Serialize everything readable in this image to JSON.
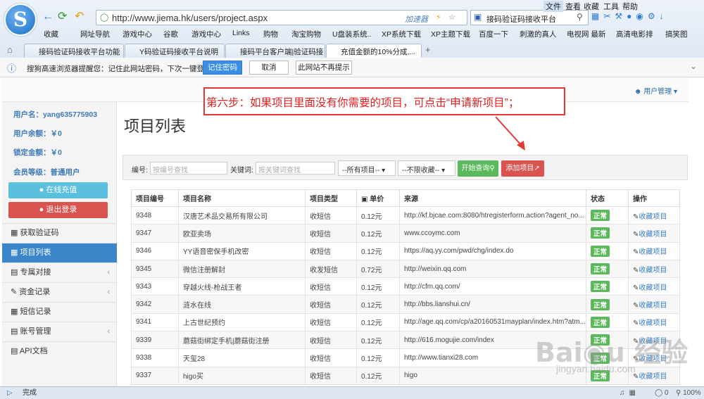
{
  "browser": {
    "url": "http://www.jiema.hk/users/project.aspx",
    "accelerator": "加速器",
    "search_text": "接码验证码接收平台",
    "menu": [
      "文件",
      "查看",
      "收藏",
      "工具",
      "帮助"
    ],
    "bookmarks": [
      "收藏",
      "网址导航",
      "游戏中心",
      "谷歌",
      "游戏中心",
      "Links",
      "购物",
      "淘宝购物",
      "U盘装系统..",
      "XP系统下载",
      "XP主题下载",
      "百度一下",
      "刺激的真人",
      "电视网 最新",
      "高清电影排",
      "搞笑图"
    ],
    "tabs": [
      "接码验证码接收平台功能",
      "Y码验证码接收平台说明",
      "接码平台客户端|验证码接",
      "充值金额的10%分成,..."
    ],
    "notice": "搜狗高速浏览器提醒您：记住此网站密码，下次一键登录！",
    "notice_buttons": [
      "记住密码",
      "取消",
      "此网站不再提示"
    ],
    "status": "完成",
    "zoom": "100%",
    "status_count": "0"
  },
  "header": {
    "user_menu": "用户管理"
  },
  "sidebar": {
    "username": "用户名：yang635775903",
    "balance": "用户余额：￥0",
    "frozen": "锁定金额：￥0",
    "level": "会员等级：普通用户",
    "recharge": "在线充值",
    "logout": "退出登录",
    "nav": [
      "获取验证码",
      "项目列表",
      "专属对接",
      "资金记录",
      "短信记录",
      "账号管理",
      "API文档"
    ]
  },
  "main": {
    "title": "项目列表",
    "filter": {
      "id_label": "编号:",
      "id_placeholder": "按编号查找",
      "kw_label": "关键词:",
      "kw_placeholder": "按关键词查找",
      "sel1": "--所有项目--",
      "sel2": "--不限收藏--",
      "query": "开始查询",
      "add": "添加项目"
    },
    "columns": [
      "项目编号",
      "项目名称",
      "项目类型",
      "单价",
      "来源",
      "状态",
      "操作"
    ],
    "rows": [
      [
        "9348",
        "汉唐艺术品交易所有限公司",
        "收短信",
        "0.12元",
        "http://kf.bjcae.com:8080/htregisterform.action?agent_no...",
        "正常",
        "收藏项目"
      ],
      [
        "9347",
        "欧亚卖场",
        "收短信",
        "0.12元",
        "www.ccoymc.com",
        "正常",
        "收藏项目"
      ],
      [
        "9346",
        "YY语音密保手机改密",
        "收短信",
        "0.12元",
        "https://aq.yy.com/pwd/chg/index.do",
        "正常",
        "收藏项目"
      ],
      [
        "9345",
        "微信注册解封",
        "收发短信",
        "0.72元",
        "http://weixin.qq.com",
        "正常",
        "收藏项目"
      ],
      [
        "9343",
        "穿越火线-枪战王者",
        "收短信",
        "0.12元",
        "http://cfm.qq.com/",
        "正常",
        "收藏项目"
      ],
      [
        "9342",
        "涟水在线",
        "收短信",
        "0.12元",
        "http://bbs.lianshui.cn/",
        "正常",
        "收藏项目"
      ],
      [
        "9341",
        "上古世纪预约",
        "收短信",
        "0.12元",
        "http://age.qq.com/cp/a20160531mayplan/index.htm?atm...",
        "正常",
        "收藏项目"
      ],
      [
        "9339",
        "蘑菇街绑定手机|蘑菇街注册",
        "收短信",
        "0.12元",
        "http://616.mogujie.com/index",
        "正常",
        "收藏项目"
      ],
      [
        "9338",
        "天玺28",
        "收短信",
        "0.12元",
        "http://www.tianxi28.com",
        "正常",
        "收藏项目"
      ],
      [
        "9337",
        "higo买",
        "收短信",
        "0.12元",
        "higo",
        "正常",
        "收藏项目"
      ]
    ]
  },
  "annotation": "第六步：如果项目里面没有你需要的项目，可点击“申请新项目”；",
  "watermark": {
    "logo": "Baidu经验",
    "url": "jingyan.baidu.com"
  }
}
